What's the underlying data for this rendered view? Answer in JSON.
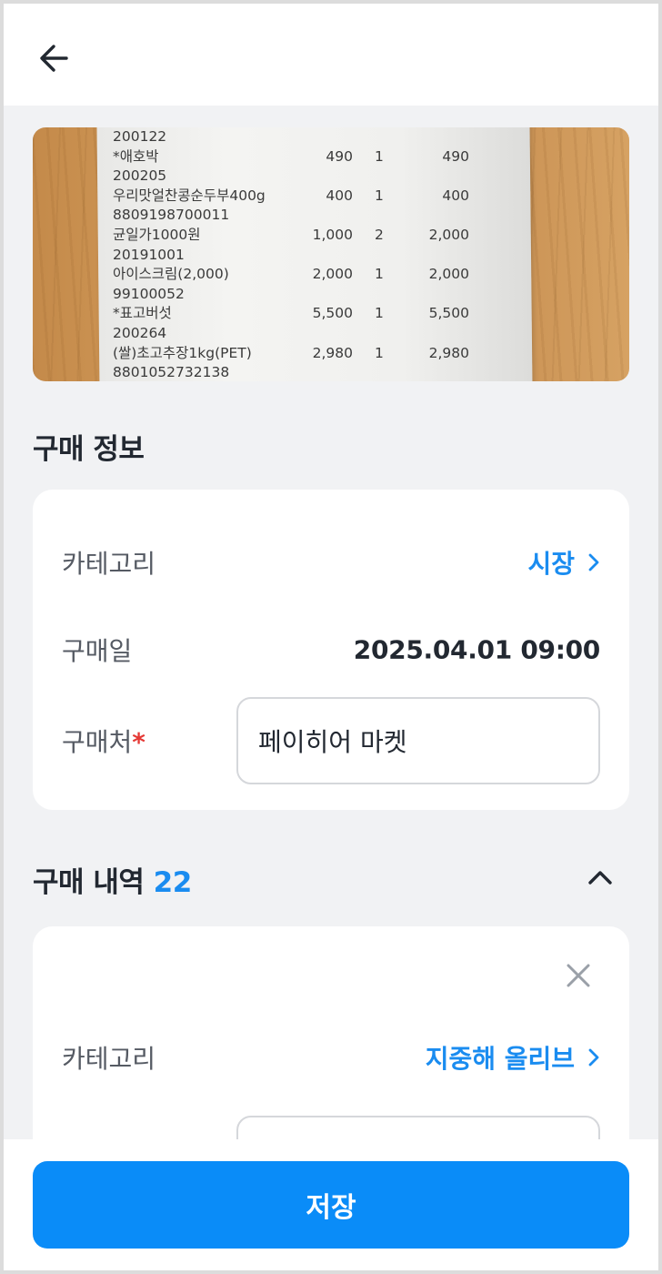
{
  "header": {
    "back_icon": "arrow-left-icon"
  },
  "receipt_image": {
    "lines": [
      {
        "name": "200122",
        "price": "",
        "qty": "",
        "amount": ""
      },
      {
        "name": "*애호박",
        "price": "490",
        "qty": "1",
        "amount": "490"
      },
      {
        "name": "200205",
        "price": "",
        "qty": "",
        "amount": ""
      },
      {
        "name": "우리맛얼찬콩순두부400g",
        "price": "400",
        "qty": "1",
        "amount": "400"
      },
      {
        "name": "8809198700011",
        "price": "",
        "qty": "",
        "amount": ""
      },
      {
        "name": "균일가1000원",
        "price": "1,000",
        "qty": "2",
        "amount": "2,000"
      },
      {
        "name": "20191001",
        "price": "",
        "qty": "",
        "amount": ""
      },
      {
        "name": "아이스크림(2,000)",
        "price": "2,000",
        "qty": "1",
        "amount": "2,000"
      },
      {
        "name": "99100052",
        "price": "",
        "qty": "",
        "amount": ""
      },
      {
        "name": "*표고버섯",
        "price": "5,500",
        "qty": "1",
        "amount": "5,500"
      },
      {
        "name": "200264",
        "price": "",
        "qty": "",
        "amount": ""
      },
      {
        "name": "(쌀)초고추장1kg(PET)",
        "price": "2,980",
        "qty": "1",
        "amount": "2,980"
      },
      {
        "name": "8801052732138",
        "price": "",
        "qty": "",
        "amount": ""
      }
    ]
  },
  "purchase_info": {
    "title": "구매 정보",
    "category_label": "카테고리",
    "category_value": "시장",
    "date_label": "구매일",
    "date_value": "2025.04.01 09:00",
    "store_label": "구매처",
    "store_required_mark": "*",
    "store_value": "페이히어 마켓"
  },
  "purchase_history": {
    "title": "구매 내역",
    "count": "22",
    "items": [
      {
        "category_label": "카테고리",
        "category_value": "지중해 올리브"
      }
    ]
  },
  "footer": {
    "save_label": "저장"
  },
  "colors": {
    "accent": "#1a8cf0",
    "button": "#0a8cf8",
    "required": "#e53935",
    "background": "#f1f2f4"
  }
}
